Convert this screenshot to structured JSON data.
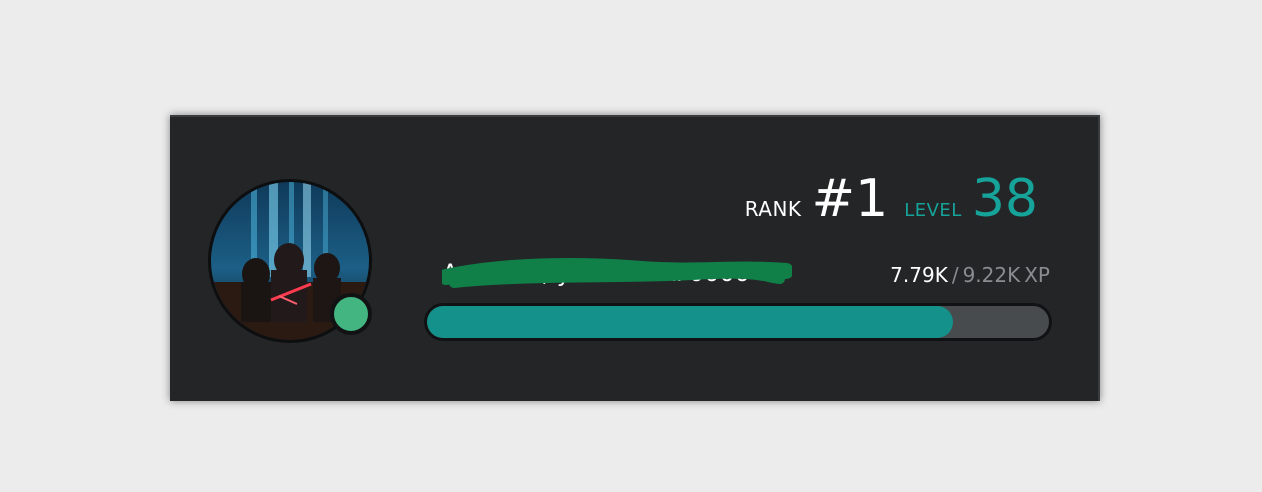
{
  "card": {
    "rank_label": "RANK",
    "rank_value": "#1",
    "level_label": "LEVEL",
    "level_value": "38",
    "username": "Arachim, you idiot #0000",
    "xp_current": "7.79K",
    "xp_separator": "/",
    "xp_total": "9.22K",
    "xp_unit": "XP",
    "progress_fraction": 0.845,
    "status": "online",
    "status_color": "#43b581",
    "accent_color": "#16a39a",
    "progress_color": "#14918a",
    "avatar_icon": "user-avatar-image"
  }
}
